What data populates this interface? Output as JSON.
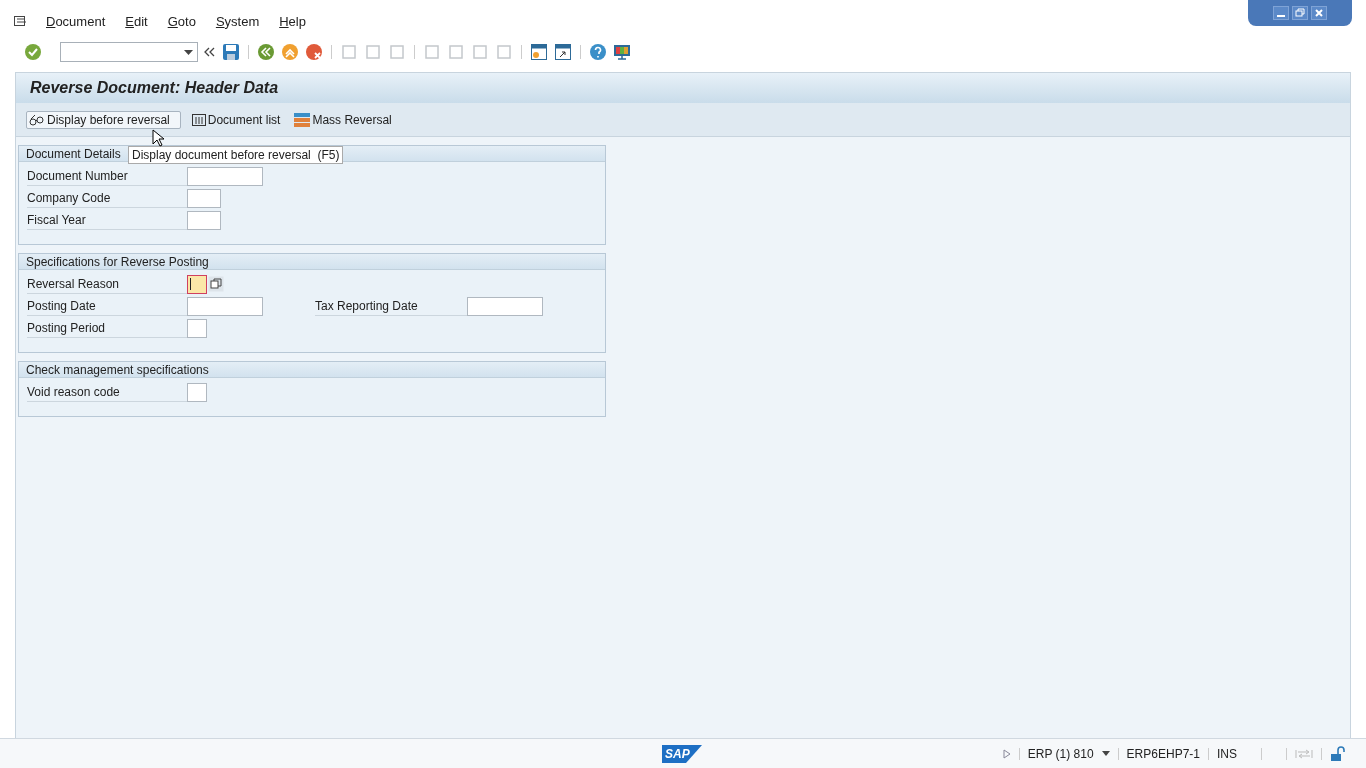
{
  "menu": [
    "Document",
    "Edit",
    "Goto",
    "System",
    "Help"
  ],
  "title": "Reverse Document: Header Data",
  "app_toolbar": [
    {
      "label": "Display before reversal",
      "kind": "glasses",
      "hovered": true
    },
    {
      "label": "Document list",
      "kind": "list",
      "hovered": false
    },
    {
      "label": "Mass Reversal",
      "kind": "mass",
      "hovered": false
    }
  ],
  "tooltip": "Display document before reversal  (F5)",
  "sections": [
    {
      "title": "Document Details",
      "rows": [
        {
          "label": "Document Number",
          "kind": "long",
          "focused": false
        },
        {
          "label": "Company Code",
          "kind": "short",
          "focused": false
        },
        {
          "label": "Fiscal Year",
          "kind": "short",
          "focused": false
        }
      ]
    },
    {
      "title": "Specifications for Reverse Posting",
      "rows": [
        {
          "label": "Reversal Reason",
          "kind": "tiny",
          "focused": true,
          "help": true
        },
        {
          "label": "Posting Date",
          "kind": "long",
          "focused": false,
          "extra": {
            "label": "Tax Reporting Date",
            "kind": "long"
          }
        },
        {
          "label": "Posting Period",
          "kind": "tiny",
          "focused": false
        }
      ]
    },
    {
      "title": "Check management specifications",
      "rows": [
        {
          "label": "Void reason code",
          "kind": "tiny",
          "focused": false
        }
      ]
    }
  ],
  "status_bar": {
    "logo": "SAP",
    "system": "ERP (1) 810",
    "server": "ERP6EHP7-1",
    "mode": "INS"
  }
}
